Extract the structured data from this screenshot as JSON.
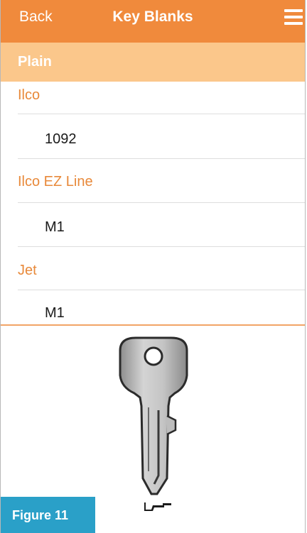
{
  "navbar": {
    "back_label": "Back",
    "title": "Key Blanks",
    "menu_icon": "hamburger-menu-icon",
    "background_color": "#f08a3c"
  },
  "section": {
    "title": "Plain",
    "background_color": "#fbc78b"
  },
  "groups": [
    {
      "label": "Ilco",
      "value": "1092"
    },
    {
      "label": "Ilco EZ Line",
      "value": "M1"
    },
    {
      "label": "Jet",
      "value": "M1"
    }
  ],
  "images": {
    "key": "key-blank-icon",
    "profile": "key-profile-icon"
  },
  "figure": {
    "label": "Figure 11",
    "background_color": "#2aa0c8"
  },
  "colors": {
    "accent": "#e8893a",
    "divider": "#dedede"
  }
}
